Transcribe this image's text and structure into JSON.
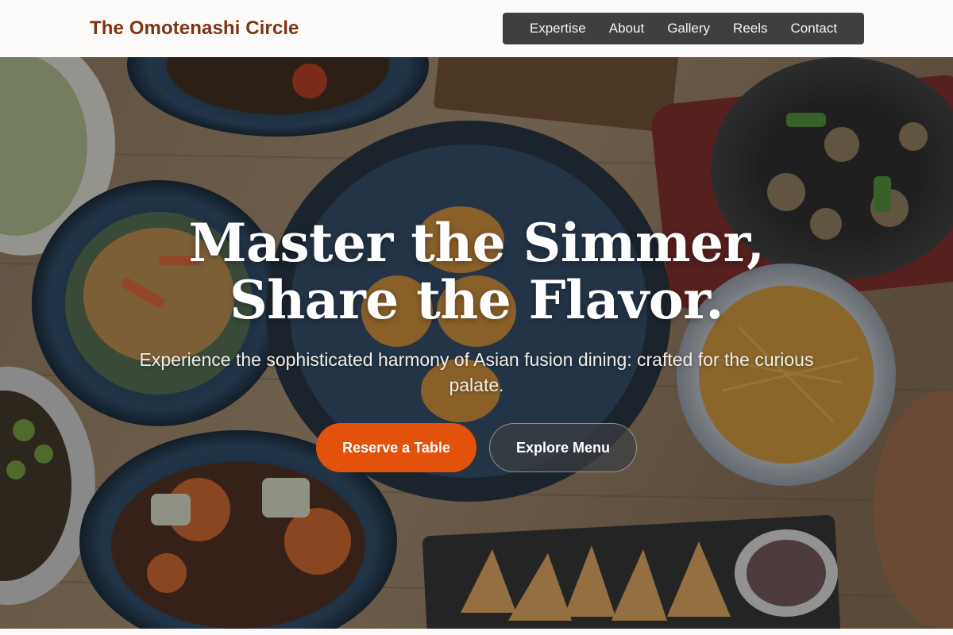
{
  "brand": {
    "name": "The Omotenashi Circle"
  },
  "nav": {
    "items": [
      {
        "label": "Expertise"
      },
      {
        "label": "About"
      },
      {
        "label": "Gallery"
      },
      {
        "label": "Reels"
      },
      {
        "label": "Contact"
      }
    ]
  },
  "hero": {
    "title_line1": "Master the Simmer,",
    "title_line2": "Share the Flavor.",
    "subtitle": "Experience the sophisticated harmony of Asian fusion dining: crafted for the curious palate.",
    "primary_cta": "Reserve a Table",
    "secondary_cta": "Explore Menu",
    "background_image": "overhead-asian-dishes-photo"
  },
  "colors": {
    "brand": "#7d3413",
    "nav_bg": "#3f3f3f",
    "primary_button": "#e2520c",
    "page_bg": "#fcfbf9"
  }
}
